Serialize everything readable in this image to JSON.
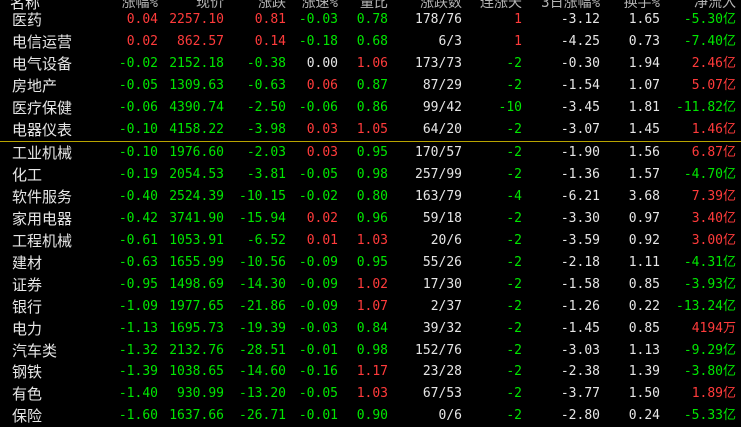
{
  "columns": {
    "name": "名称",
    "change_pct": "涨幅%",
    "price": "现价",
    "change": "涨跌",
    "speed": "涨速%",
    "volume_ratio": "量比",
    "up_down": "涨跌数",
    "consec_up": "连涨天",
    "change_3d": "3日涨幅%",
    "turnover": "换手%",
    "net_inflow": "净流入"
  },
  "rows": [
    {
      "name": "医药",
      "change_pct": "0.04",
      "price": "2257.10",
      "change": "0.81",
      "speed": "-0.03",
      "volume_ratio": "0.78",
      "up_down": "178/76",
      "consec_up": "1",
      "change_3d": "-3.12",
      "turnover": "1.65",
      "net_inflow": "-5.30亿"
    },
    {
      "name": "电信运营",
      "change_pct": "0.02",
      "price": "862.57",
      "change": "0.14",
      "speed": "-0.18",
      "volume_ratio": "0.68",
      "up_down": "6/3",
      "consec_up": "1",
      "change_3d": "-4.25",
      "turnover": "0.73",
      "net_inflow": "-7.40亿"
    },
    {
      "name": "电气设备",
      "change_pct": "-0.02",
      "price": "2152.18",
      "change": "-0.38",
      "speed": "0.00",
      "volume_ratio": "1.06",
      "up_down": "173/73",
      "consec_up": "-2",
      "change_3d": "-0.30",
      "turnover": "1.94",
      "net_inflow": "2.46亿"
    },
    {
      "name": "房地产",
      "change_pct": "-0.05",
      "price": "1309.63",
      "change": "-0.63",
      "speed": "0.06",
      "volume_ratio": "0.87",
      "up_down": "87/29",
      "consec_up": "-2",
      "change_3d": "-1.54",
      "turnover": "1.07",
      "net_inflow": "5.07亿"
    },
    {
      "name": "医疗保健",
      "change_pct": "-0.06",
      "price": "4390.74",
      "change": "-2.50",
      "speed": "-0.06",
      "volume_ratio": "0.86",
      "up_down": "99/42",
      "consec_up": "-10",
      "change_3d": "-3.45",
      "turnover": "1.81",
      "net_inflow": "-11.82亿"
    },
    {
      "name": "电器仪表",
      "change_pct": "-0.10",
      "price": "4158.22",
      "change": "-3.98",
      "speed": "0.03",
      "volume_ratio": "1.05",
      "up_down": "64/20",
      "consec_up": "-2",
      "change_3d": "-3.07",
      "turnover": "1.45",
      "net_inflow": "1.46亿"
    },
    {
      "name": "工业机械",
      "change_pct": "-0.10",
      "price": "1976.60",
      "change": "-2.03",
      "speed": "0.03",
      "volume_ratio": "0.95",
      "up_down": "170/57",
      "consec_up": "-2",
      "change_3d": "-1.90",
      "turnover": "1.56",
      "net_inflow": "6.87亿"
    },
    {
      "name": "化工",
      "change_pct": "-0.19",
      "price": "2054.53",
      "change": "-3.81",
      "speed": "-0.05",
      "volume_ratio": "0.98",
      "up_down": "257/99",
      "consec_up": "-2",
      "change_3d": "-1.36",
      "turnover": "1.57",
      "net_inflow": "-4.70亿"
    },
    {
      "name": "软件服务",
      "change_pct": "-0.40",
      "price": "2524.39",
      "change": "-10.15",
      "speed": "-0.02",
      "volume_ratio": "0.80",
      "up_down": "163/79",
      "consec_up": "-4",
      "change_3d": "-6.21",
      "turnover": "3.68",
      "net_inflow": "7.39亿"
    },
    {
      "name": "家用电器",
      "change_pct": "-0.42",
      "price": "3741.90",
      "change": "-15.94",
      "speed": "0.02",
      "volume_ratio": "0.96",
      "up_down": "59/18",
      "consec_up": "-2",
      "change_3d": "-3.30",
      "turnover": "0.97",
      "net_inflow": "3.40亿"
    },
    {
      "name": "工程机械",
      "change_pct": "-0.61",
      "price": "1053.91",
      "change": "-6.52",
      "speed": "0.01",
      "volume_ratio": "1.03",
      "up_down": "20/6",
      "consec_up": "-2",
      "change_3d": "-3.59",
      "turnover": "0.92",
      "net_inflow": "3.00亿"
    },
    {
      "name": "建材",
      "change_pct": "-0.63",
      "price": "1655.99",
      "change": "-10.56",
      "speed": "-0.09",
      "volume_ratio": "0.95",
      "up_down": "55/26",
      "consec_up": "-2",
      "change_3d": "-2.18",
      "turnover": "1.11",
      "net_inflow": "-4.31亿"
    },
    {
      "name": "证券",
      "change_pct": "-0.95",
      "price": "1498.69",
      "change": "-14.30",
      "speed": "-0.09",
      "volume_ratio": "1.02",
      "up_down": "17/30",
      "consec_up": "-2",
      "change_3d": "-1.58",
      "turnover": "0.85",
      "net_inflow": "-3.93亿"
    },
    {
      "name": "银行",
      "change_pct": "-1.09",
      "price": "1977.65",
      "change": "-21.86",
      "speed": "-0.09",
      "volume_ratio": "1.07",
      "up_down": "2/37",
      "consec_up": "-2",
      "change_3d": "-1.26",
      "turnover": "0.22",
      "net_inflow": "-13.24亿"
    },
    {
      "name": "电力",
      "change_pct": "-1.13",
      "price": "1695.73",
      "change": "-19.39",
      "speed": "-0.03",
      "volume_ratio": "0.84",
      "up_down": "39/32",
      "consec_up": "-2",
      "change_3d": "-1.45",
      "turnover": "0.85",
      "net_inflow": "4194万"
    },
    {
      "name": "汽车类",
      "change_pct": "-1.32",
      "price": "2132.76",
      "change": "-28.51",
      "speed": "-0.01",
      "volume_ratio": "0.98",
      "up_down": "152/76",
      "consec_up": "-2",
      "change_3d": "-3.03",
      "turnover": "1.13",
      "net_inflow": "-9.29亿"
    },
    {
      "name": "钢铁",
      "change_pct": "-1.39",
      "price": "1038.65",
      "change": "-14.60",
      "speed": "-0.16",
      "volume_ratio": "1.17",
      "up_down": "23/28",
      "consec_up": "-2",
      "change_3d": "-2.38",
      "turnover": "1.39",
      "net_inflow": "-3.80亿"
    },
    {
      "name": "有色",
      "change_pct": "-1.40",
      "price": "930.99",
      "change": "-13.20",
      "speed": "-0.05",
      "volume_ratio": "1.03",
      "up_down": "67/53",
      "consec_up": "-2",
      "change_3d": "-3.77",
      "turnover": "1.50",
      "net_inflow": "1.89亿"
    },
    {
      "name": "保险",
      "change_pct": "-1.60",
      "price": "1637.66",
      "change": "-26.71",
      "speed": "-0.01",
      "volume_ratio": "0.90",
      "up_down": "0/6",
      "consec_up": "-2",
      "change_3d": "-2.80",
      "turnover": "0.24",
      "net_inflow": "-5.33亿"
    }
  ],
  "colors": {
    "up": "#ff3b3b",
    "down": "#00e600",
    "neutral": "#e6e6e6",
    "divider": "#b8a400"
  }
}
